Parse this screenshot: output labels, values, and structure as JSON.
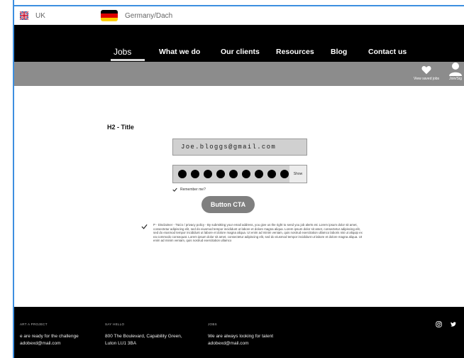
{
  "regions": {
    "uk": "UK",
    "germany": "Germany/Dach"
  },
  "nav": {
    "items": [
      "Jobs",
      "What we do",
      "Our clients",
      "Resources",
      "Blog",
      "Contact us"
    ],
    "active": "Jobs"
  },
  "utility": {
    "saved_jobs": "View saved jobs",
    "join": "Join/Sig"
  },
  "form": {
    "title": "H2 - Title",
    "email_value": "Joe.bloggs@gmail.com",
    "show_label": "Show",
    "remember_label": "Remember me?",
    "cta_label": "Button CTA",
    "disclaimer": "P - Disclaimer - T&Cs / privacy policy - By submitting your email address, you give us the right to send you job alerts etc Lorem ipsum dolor sit amet, consectetur adipiscing elit, sed do eiusmod tempor incididunt ut labore et dolore magna aliqua. Lorem ipsum dolor sit amet, consectetur adipiscing elit, sed do eiusmod tempor incididunt ut labore et dolore magna aliqua. Ut enim ad minim veniam, quis nostrud exercitation ullamco laboris nisi ut aliquip ex ea commodo consequat. Lorem ipsum dolor sit amet, consectetur adipiscing elit, sed do eiusmod tempor incididunt ut labore et dolore magna aliqua. Ut enim ad minim veniam, quis nostrud exercitation ullamco"
  },
  "footer": {
    "col1": {
      "heading": "ART A PROJECT",
      "line1": "e are ready for the challenge",
      "line2": "adobexd@mail.com"
    },
    "col2": {
      "heading": "SAY HELLO",
      "line1": "800 The Boulevard, Capability Green,",
      "line2": "Luton LU1 3BA"
    },
    "col3": {
      "heading": "JOBS",
      "line1": "We are always looking for talent",
      "line2": "adobexd@mail.com"
    },
    "icons": [
      "instagram-icon",
      "twitter-icon"
    ]
  },
  "colors": {
    "accent_line": "#3d8fe0",
    "nav_bg": "#000000",
    "subbar_bg": "#8c8c8c",
    "cta_bg": "#7f7f7f"
  }
}
